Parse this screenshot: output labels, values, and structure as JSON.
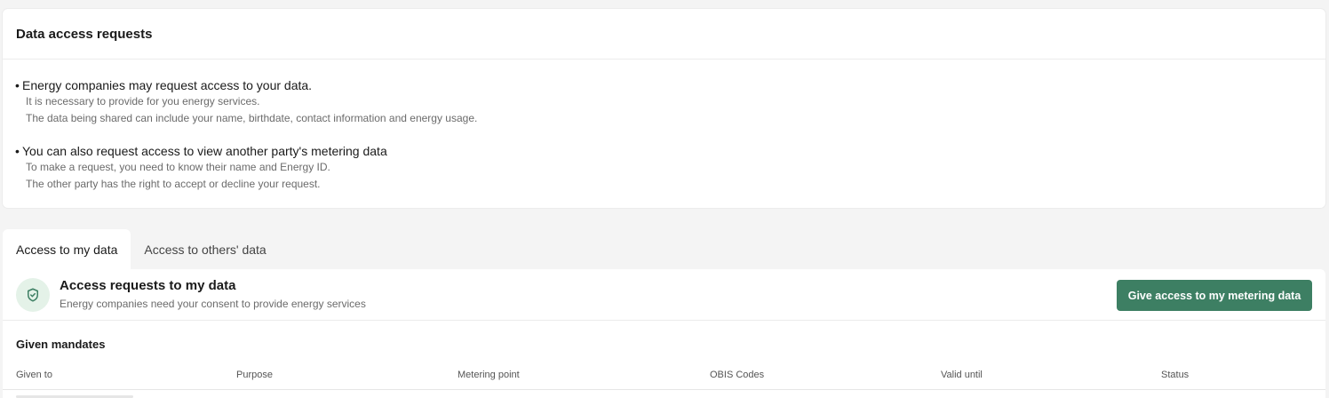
{
  "info": {
    "title": "Data access requests",
    "bullets": [
      {
        "main": "Energy companies may request access to your data.",
        "sub": [
          "It is necessary to provide for you energy services.",
          "The data being shared can include your name, birthdate, contact information and energy usage."
        ]
      },
      {
        "main": "You can also request access to view another party's metering data",
        "sub": [
          "To make a request, you need to know their name and Energy ID.",
          "The other party has the right to accept or decline your request."
        ]
      }
    ]
  },
  "tabs": [
    {
      "label": "Access to my data",
      "active": true
    },
    {
      "label": "Access to others' data",
      "active": false
    }
  ],
  "panel": {
    "icon": "shield-check-icon",
    "title": "Access requests to my data",
    "subtitle": "Energy companies need your consent to provide energy services",
    "button_label": "Give access to my metering data"
  },
  "mandates": {
    "title": "Given mandates",
    "columns": [
      "Given to",
      "Purpose",
      "Metering point",
      "OBIS Codes",
      "Valid until",
      "Status"
    ]
  },
  "colors": {
    "accent": "#3d7f63",
    "icon_bg": "#e4f2e8",
    "background": "#f4f4f4"
  }
}
